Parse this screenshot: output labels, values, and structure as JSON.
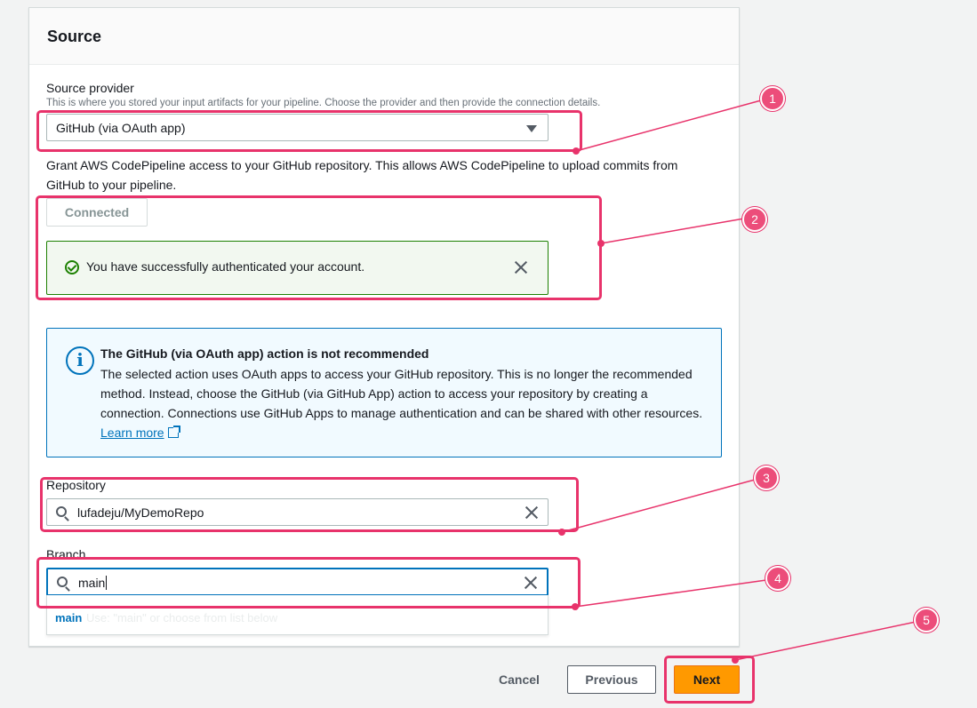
{
  "section": {
    "title": "Source"
  },
  "source_provider": {
    "label": "Source provider",
    "description": "This is where you stored your input artifacts for your pipeline. Choose the provider and then provide the connection details.",
    "selected": "GitHub (via OAuth app)"
  },
  "grant": {
    "text": "Grant AWS CodePipeline access to your GitHub repository. This allows AWS CodePipeline to upload commits from GitHub to your pipeline.",
    "connected_label": "Connected"
  },
  "success_alert": {
    "message": "You have successfully authenticated your account."
  },
  "info_alert": {
    "title": "The GitHub (via OAuth app) action is not recommended",
    "text": "The selected action uses OAuth apps to access your GitHub repository. This is no longer the recommended method. Instead, choose the GitHub (via GitHub App) action to access your repository by creating a connection. Connections use GitHub Apps to manage authentication and can be shared with other resources.",
    "link": "Learn more"
  },
  "repository": {
    "label": "Repository",
    "value": "lufadeju/MyDemoRepo"
  },
  "branch": {
    "label": "Branch",
    "value": "main",
    "suggestion": "main",
    "suggestion_hint": "Use: \"main\" or choose from list below"
  },
  "footer": {
    "cancel": "Cancel",
    "previous": "Previous",
    "next": "Next"
  },
  "annotations": [
    "1",
    "2",
    "3",
    "4",
    "5"
  ],
  "colors": {
    "accent": "#0073bb",
    "primary_button": "#ff9900",
    "success": "#1d8102",
    "annotation": "#e8336b"
  }
}
